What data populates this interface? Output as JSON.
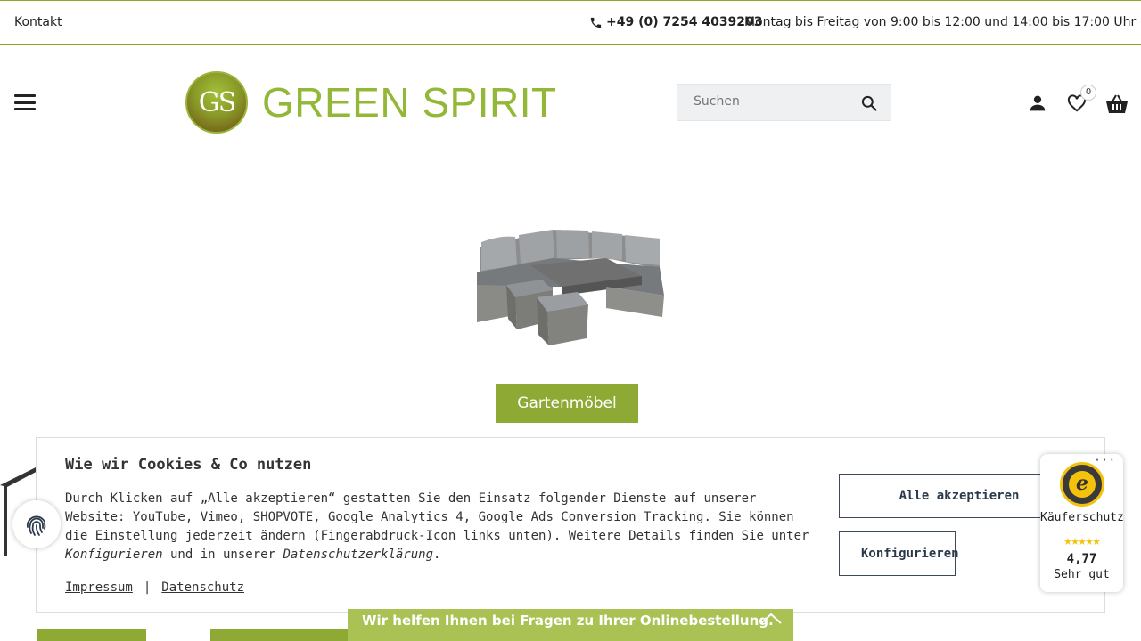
{
  "topbar": {
    "contact_label": "Kontakt",
    "phone": "+49 (0) 7254 4039203",
    "hours": "Montag bis Freitag von 9:00 bis 12:00 und 14:00 bis 17:00 Uhr"
  },
  "header": {
    "logo_initials": "GS",
    "logo_text": "GREEN SPIRIT",
    "search_placeholder": "Suchen",
    "wishlist_count": "0",
    "icons": [
      "menu-icon",
      "search-icon",
      "user-icon",
      "heart-icon",
      "basket-icon",
      "phone-icon"
    ]
  },
  "main": {
    "category_button": "Gartenmöbel"
  },
  "cookie_banner": {
    "title": "Wie wir Cookies & Co nutzen",
    "text_part1": "Durch Klicken auf „Alle akzeptieren“ gestatten Sie den Einsatz folgender Dienste auf unserer Website: YouTube, Vimeo, SHOPVOTE, Google Analytics 4, Google Ads Conversion Tracking. Sie können die Einstellung jederzeit ändern (Fingerabdruck-Icon links unten). Weitere Details finden Sie unter ",
    "text_link1": "Konfigurieren",
    "text_part2": " und in unserer ",
    "text_link2": "Datenschutzerklärung",
    "text_part3": ".",
    "link_impressum": "Impressum",
    "separator": "|",
    "link_datenschutz": "Datenschutz",
    "accept_all": "Alle akzeptieren",
    "configure": "Konfigurieren"
  },
  "trusted_shops": {
    "seal_letter": "e",
    "label": "Käuferschutz",
    "stars": "★★★★★",
    "rating": "4,77",
    "rating_text": "Sehr gut"
  },
  "help_bar": {
    "text": "Wir helfen Ihnen bei Fragen zu Ihrer Onlinebestellung."
  },
  "colors": {
    "brand_green": "#8fa935",
    "logo_green": "#93b837",
    "border_green": "#8aab2b",
    "star_yellow": "#f4c20d"
  }
}
